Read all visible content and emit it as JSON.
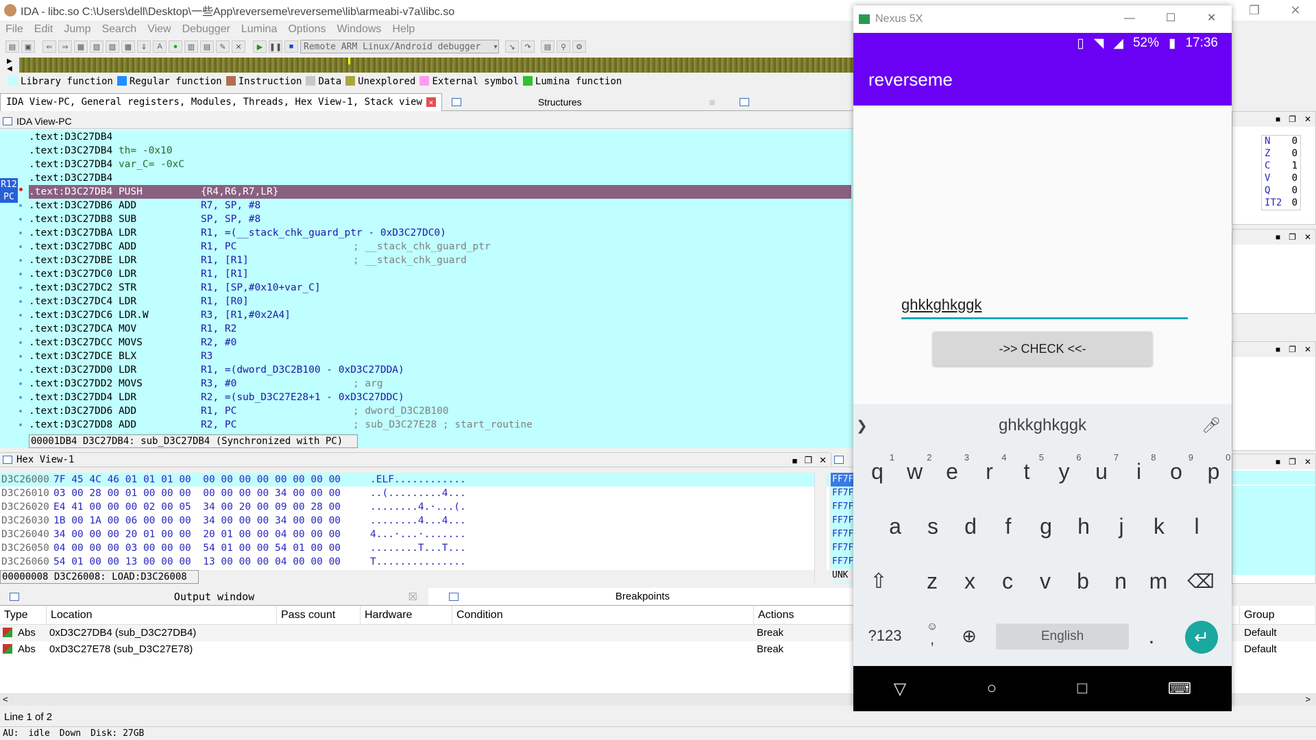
{
  "ida": {
    "title": "IDA - libc.so C:\\Users\\dell\\Desktop\\一些App\\reverseme\\reverseme\\lib\\armeabi-v7a\\libc.so",
    "menu": [
      "File",
      "Edit",
      "Jump",
      "Search",
      "View",
      "Debugger",
      "Lumina",
      "Options",
      "Windows",
      "Help"
    ],
    "debugger_select": "Remote ARM Linux/Android debugger",
    "legend": [
      {
        "label": "Library function",
        "color": "#c0ffff"
      },
      {
        "label": "Regular function",
        "color": "#1e90ff"
      },
      {
        "label": "Instruction",
        "color": "#b07050"
      },
      {
        "label": "Data",
        "color": "#c8c8c8"
      },
      {
        "label": "Unexplored",
        "color": "#a8a840"
      },
      {
        "label": "External symbol",
        "color": "#ff9cf0"
      },
      {
        "label": "Lumina function",
        "color": "#30c030"
      }
    ],
    "tabs": {
      "main": "IDA View-PC, General registers, Modules, Threads, Hex View-1, Stack view",
      "structures": "Structures"
    },
    "disasm_title": "IDA View-PC",
    "reg_tags": [
      "R12",
      "PC"
    ],
    "disasm": [
      {
        "addr": ".text:D3C27DB4",
        "mn": "",
        "op": "",
        "cm": ""
      },
      {
        "addr": ".text:D3C27DB4",
        "mn": "th= -0x10",
        "op": "",
        "cm": ""
      },
      {
        "addr": ".text:D3C27DB4",
        "mn": "var_C= -0xC",
        "op": "",
        "cm": ""
      },
      {
        "addr": ".text:D3C27DB4",
        "mn": "",
        "op": "",
        "cm": ""
      },
      {
        "addr": ".text:D3C27DB4",
        "mn": "PUSH",
        "op": "{R4,R6,R7,LR}",
        "cm": ""
      },
      {
        "addr": ".text:D3C27DB6",
        "mn": "ADD",
        "op": "R7, SP, #8",
        "cm": ""
      },
      {
        "addr": ".text:D3C27DB8",
        "mn": "SUB",
        "op": "SP, SP, #8",
        "cm": ""
      },
      {
        "addr": ".text:D3C27DBA",
        "mn": "LDR",
        "op": "R1, =(__stack_chk_guard_ptr - 0xD3C27DC0)",
        "cm": ""
      },
      {
        "addr": ".text:D3C27DBC",
        "mn": "ADD",
        "op": "R1, PC",
        "cm": "; __stack_chk_guard_ptr"
      },
      {
        "addr": ".text:D3C27DBE",
        "mn": "LDR",
        "op": "R1, [R1]",
        "cm": "; __stack_chk_guard"
      },
      {
        "addr": ".text:D3C27DC0",
        "mn": "LDR",
        "op": "R1, [R1]",
        "cm": ""
      },
      {
        "addr": ".text:D3C27DC2",
        "mn": "STR",
        "op": "R1, [SP,#0x10+var_C]",
        "cm": ""
      },
      {
        "addr": ".text:D3C27DC4",
        "mn": "LDR",
        "op": "R1, [R0]",
        "cm": ""
      },
      {
        "addr": ".text:D3C27DC6",
        "mn": "LDR.W",
        "op": "R3, [R1,#0x2A4]",
        "cm": ""
      },
      {
        "addr": ".text:D3C27DCA",
        "mn": "MOV",
        "op": "R1, R2",
        "cm": ""
      },
      {
        "addr": ".text:D3C27DCC",
        "mn": "MOVS",
        "op": "R2, #0",
        "cm": ""
      },
      {
        "addr": ".text:D3C27DCE",
        "mn": "BLX",
        "op": "R3",
        "cm": ""
      },
      {
        "addr": ".text:D3C27DD0",
        "mn": "LDR",
        "op": "R1, =(dword_D3C2B100 - 0xD3C27DDA)",
        "cm": ""
      },
      {
        "addr": ".text:D3C27DD2",
        "mn": "MOVS",
        "op": "R3, #0",
        "cm": "; arg"
      },
      {
        "addr": ".text:D3C27DD4",
        "mn": "LDR",
        "op": "R2, =(sub_D3C27E28+1 - 0xD3C27DDC)",
        "cm": ""
      },
      {
        "addr": ".text:D3C27DD6",
        "mn": "ADD",
        "op": "R1, PC",
        "cm": "; dword_D3C2B100"
      },
      {
        "addr": ".text:D3C27DD8",
        "mn": "ADD",
        "op": "R2, PC",
        "cm": "; sub_D3C27E28 ; start_routine"
      }
    ],
    "disasm_status": "00001DB4 D3C27DB4: sub_D3C27DB4 (Synchronized with PC)",
    "hex_title": "Hex View-1",
    "hex": [
      {
        "addr": "D3C26000",
        "bytes": "7F 45 4C 46 01 01 01 00  00 00 00 00 00 00 00 00",
        "ascii": ".ELF............"
      },
      {
        "addr": "D3C26010",
        "bytes": "03 00 28 00 01 00 00 00  00 00 00 00 34 00 00 00",
        "ascii": "..(.........4..."
      },
      {
        "addr": "D3C26020",
        "bytes": "E4 41 00 00 00 02 00 05  34 00 20 00 09 00 28 00",
        "ascii": "........4.·...(."
      },
      {
        "addr": "D3C26030",
        "bytes": "1B 00 1A 00 06 00 00 00  34 00 00 00 34 00 00 00",
        "ascii": "........4...4..."
      },
      {
        "addr": "D3C26040",
        "bytes": "34 00 00 00 20 01 00 00  20 01 00 00 04 00 00 00",
        "ascii": "4...·...·......."
      },
      {
        "addr": "D3C26050",
        "bytes": "04 00 00 00 03 00 00 00  54 01 00 00 54 01 00 00",
        "ascii": "........T...T..."
      },
      {
        "addr": "D3C26060",
        "bytes": "54 01 00 00 13 00 00 00  13 00 00 00 04 00 00 00",
        "ascii": "T..............."
      }
    ],
    "hex_status": "00000008 D3C26008: LOAD:D3C26008",
    "stack_rows": [
      "FF7F",
      "FF7F",
      "FF7F",
      "FF7F",
      "FF7F",
      "FF7F",
      "FF7F",
      "UNK"
    ],
    "flags": [
      {
        "n": "N",
        "v": "0"
      },
      {
        "n": "Z",
        "v": "0"
      },
      {
        "n": "C",
        "v": "1"
      },
      {
        "n": "V",
        "v": "0"
      },
      {
        "n": "Q",
        "v": "0"
      },
      {
        "n": "IT2",
        "v": "0"
      }
    ],
    "bottom_tabs": {
      "output": "Output window",
      "breakpoints": "Breakpoints"
    },
    "bp_headers": {
      "type": "Type",
      "location": "Location",
      "pass": "Pass count",
      "hardware": "Hardware",
      "condition": "Condition",
      "actions": "Actions",
      "group": "Group"
    },
    "breakpoints": [
      {
        "type": "Abs",
        "location": "0xD3C27DB4 (sub_D3C27DB4)",
        "action": "Break",
        "group": "Default"
      },
      {
        "type": "Abs",
        "location": "0xD3C27E78 (sub_D3C27E78)",
        "action": "Break",
        "group": "Default"
      }
    ],
    "line_info": "Line 1 of 2",
    "status": {
      "au": "AU:",
      "state": "idle",
      "dir": "Down",
      "disk": "Disk: 27GB"
    }
  },
  "phone": {
    "window_title": "Nexus 5X",
    "battery": "52%",
    "time": "17:36",
    "app_title": "reverseme",
    "input_value": "ghkkghkggk",
    "check_label": "->> CHECK <<-",
    "suggestion": "ghkkghkggk",
    "row1": [
      {
        "k": "q",
        "n": "1"
      },
      {
        "k": "w",
        "n": "2"
      },
      {
        "k": "e",
        "n": "3"
      },
      {
        "k": "r",
        "n": "4"
      },
      {
        "k": "t",
        "n": "5"
      },
      {
        "k": "y",
        "n": "6"
      },
      {
        "k": "u",
        "n": "7"
      },
      {
        "k": "i",
        "n": "8"
      },
      {
        "k": "o",
        "n": "9"
      },
      {
        "k": "p",
        "n": "0"
      }
    ],
    "row2": [
      "a",
      "s",
      "d",
      "f",
      "g",
      "h",
      "j",
      "k",
      "l"
    ],
    "row3": [
      "z",
      "x",
      "c",
      "v",
      "b",
      "n",
      "m"
    ],
    "sym_label": "?123",
    "comma": ",",
    "period": ".",
    "space_label": "English"
  }
}
